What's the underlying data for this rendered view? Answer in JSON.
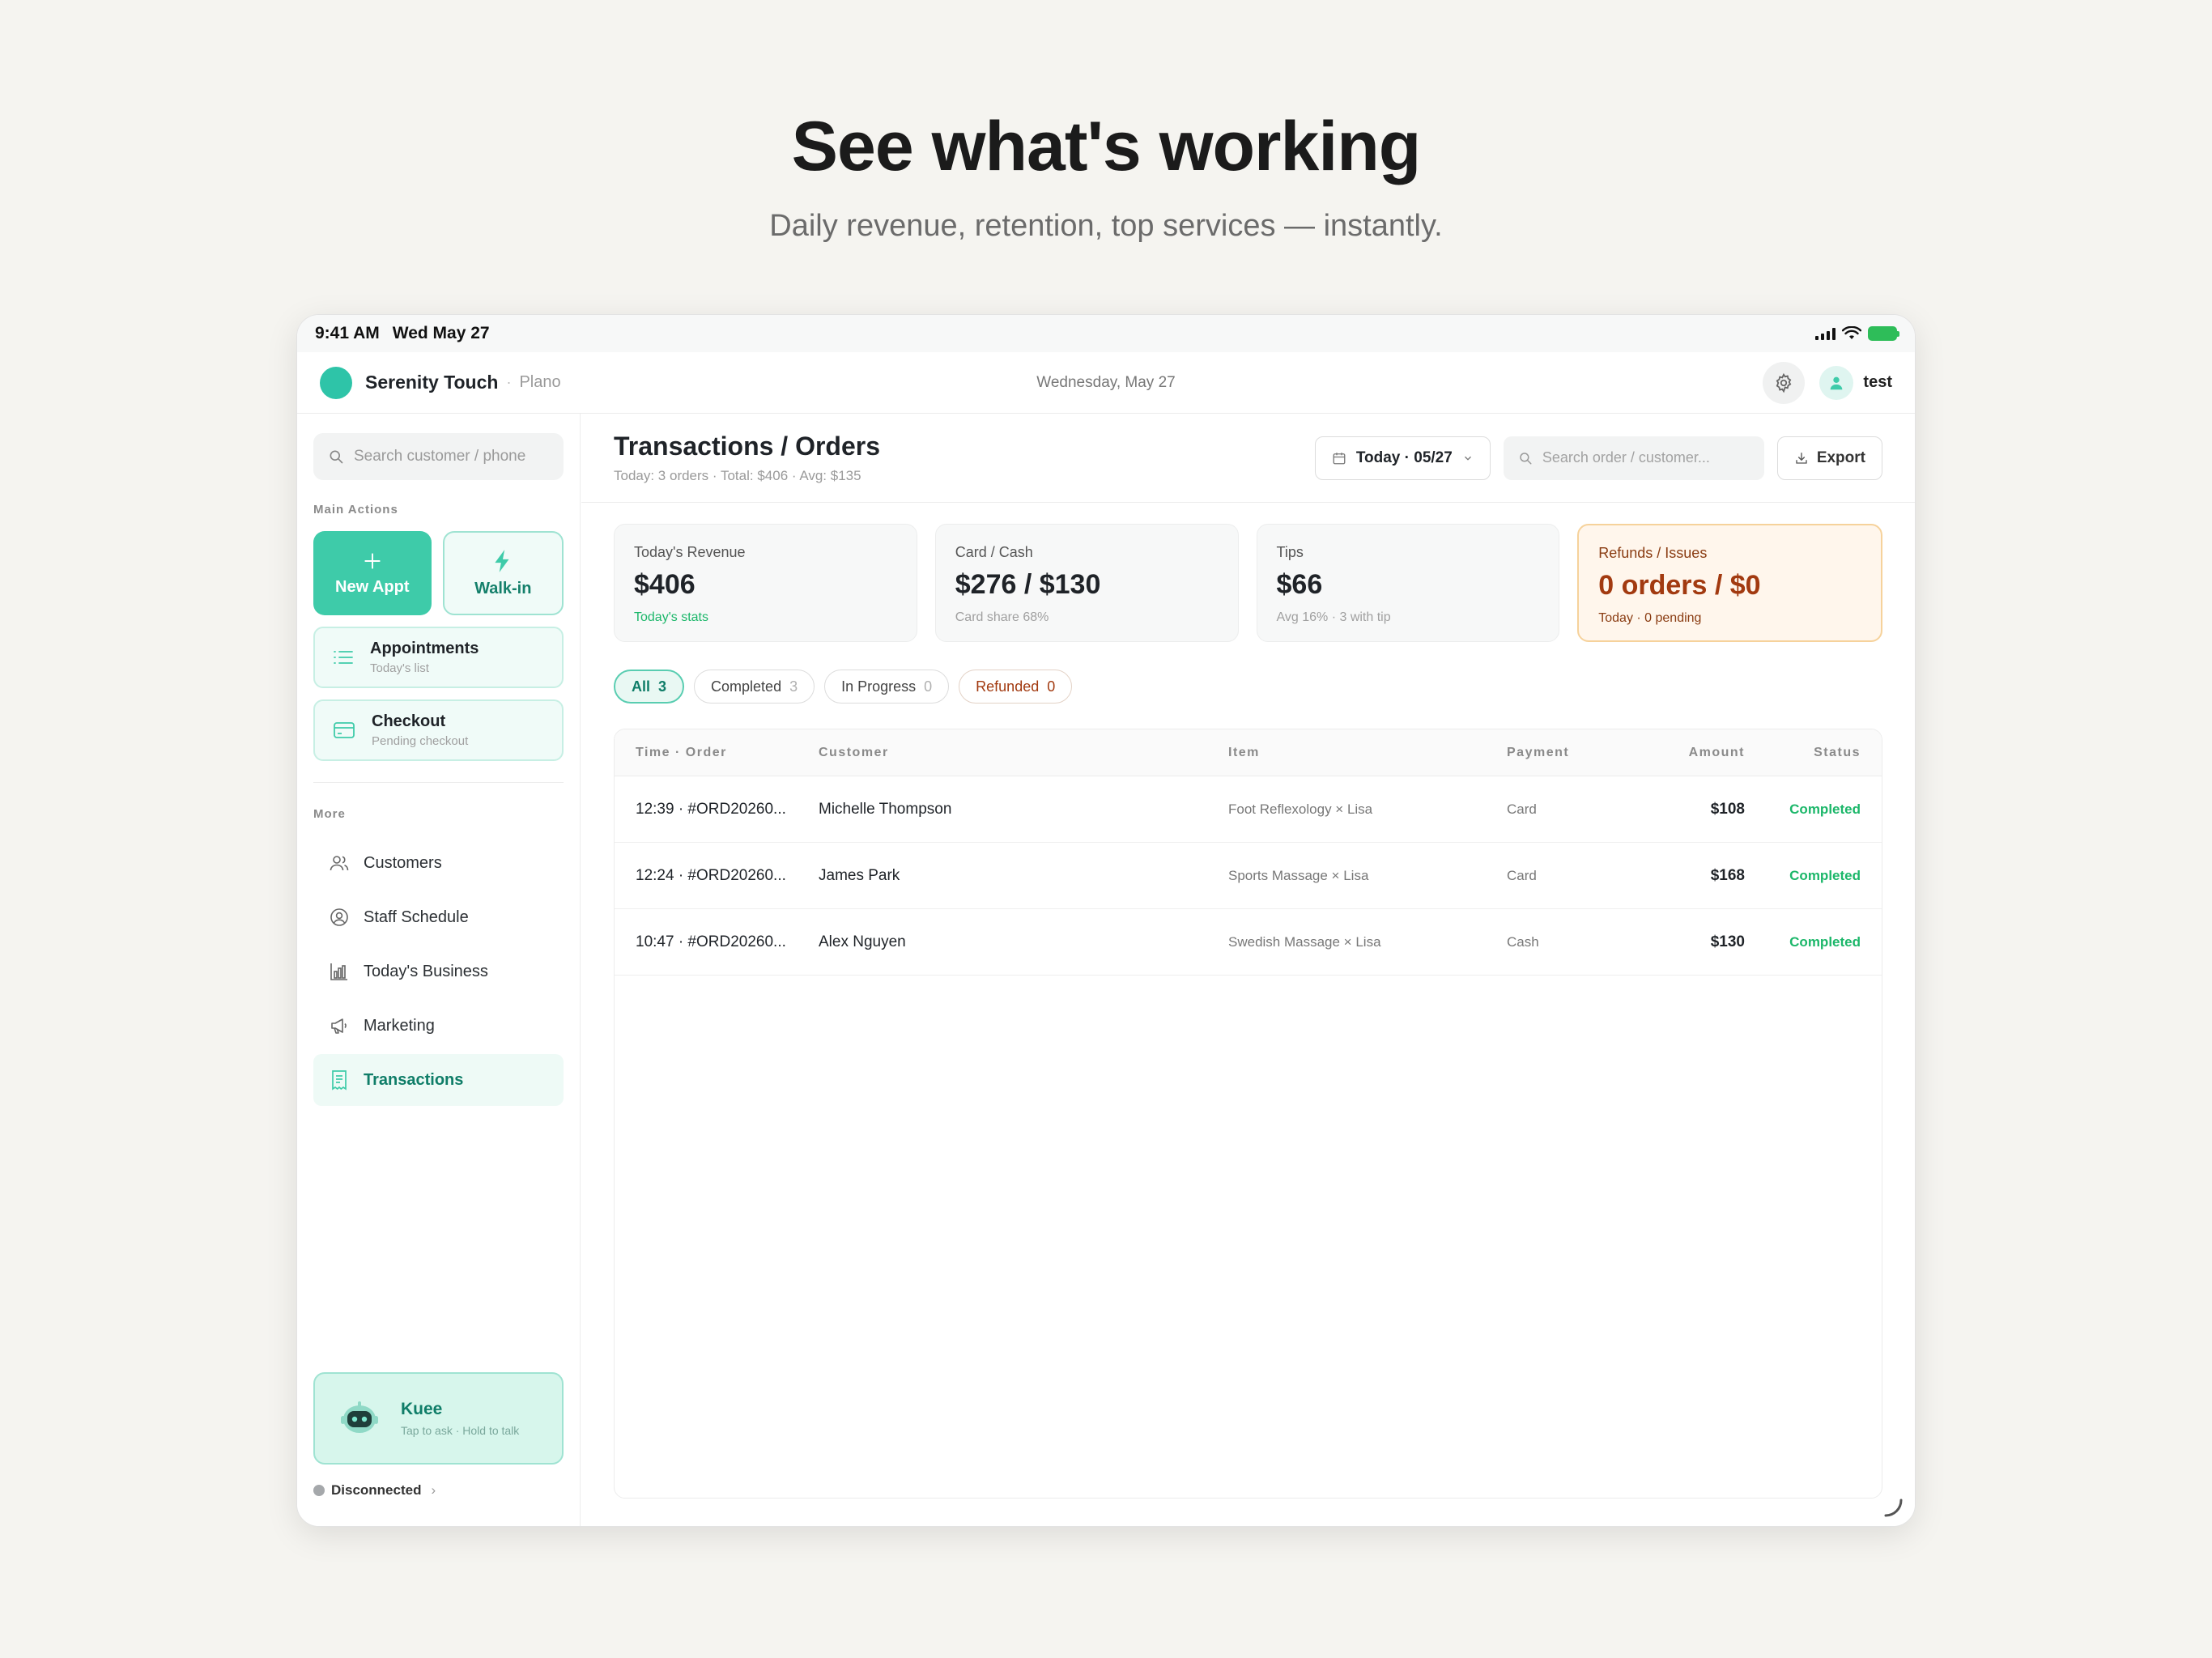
{
  "hero": {
    "title": "See what's working",
    "subtitle": "Daily revenue, retention, top services — instantly."
  },
  "statusbar": {
    "time": "9:41 AM",
    "date": "Wed May 27"
  },
  "header": {
    "brand": "Serenity Touch",
    "separator": "·",
    "location": "Plano",
    "date": "Wednesday, May 27",
    "user": "test"
  },
  "sidebar": {
    "search_placeholder": "Search customer / phone",
    "main_actions_label": "Main Actions",
    "new_appt": "New Appt",
    "walk_in": "Walk-in",
    "appointments": {
      "title": "Appointments",
      "subtitle": "Today's list"
    },
    "checkout": {
      "title": "Checkout",
      "subtitle": "Pending checkout"
    },
    "more_label": "More",
    "more_items": [
      {
        "label": "Customers",
        "icon": "users-icon"
      },
      {
        "label": "Staff Schedule",
        "icon": "user-circle-icon"
      },
      {
        "label": "Today's Business",
        "icon": "bar-chart-icon"
      },
      {
        "label": "Marketing",
        "icon": "megaphone-icon"
      },
      {
        "label": "Transactions",
        "icon": "receipt-icon",
        "active": true
      }
    ],
    "assistant": {
      "name": "Kuee",
      "hint": "Tap to ask · Hold to talk"
    },
    "connection": {
      "status": "Disconnected",
      "chevron": "›"
    }
  },
  "main": {
    "title": "Transactions / Orders",
    "subtitle": "Today: 3 orders · Total: $406 · Avg: $135",
    "date_filter": "Today · 05/27",
    "search_placeholder": "Search order / customer...",
    "export": "Export"
  },
  "stats": [
    {
      "label": "Today's Revenue",
      "value": "$406",
      "note": "Today's stats"
    },
    {
      "label": "Card / Cash",
      "value": "$276 / $130",
      "note": "Card share 68%"
    },
    {
      "label": "Tips",
      "value": "$66",
      "note": "Avg 16% · 3 with tip"
    },
    {
      "label": "Refunds / Issues",
      "value": "0 orders / $0",
      "note": "Today · 0 pending"
    }
  ],
  "filters": [
    {
      "label": "All",
      "count": "3"
    },
    {
      "label": "Completed",
      "count": "3"
    },
    {
      "label": "In Progress",
      "count": "0"
    },
    {
      "label": "Refunded",
      "count": "0"
    }
  ],
  "table": {
    "columns": [
      "Time · Order",
      "Customer",
      "Item",
      "Payment",
      "Amount",
      "Status"
    ],
    "rows": [
      {
        "time_order": "12:39 · #ORD20260...",
        "customer": "Michelle Thompson",
        "item": "Foot Reflexology × Lisa",
        "payment": "Card",
        "amount": "$108",
        "status": "Completed"
      },
      {
        "time_order": "12:24 · #ORD20260...",
        "customer": "James Park",
        "item": "Sports Massage × Lisa",
        "payment": "Card",
        "amount": "$168",
        "status": "Completed"
      },
      {
        "time_order": "10:47 · #ORD20260...",
        "customer": "Alex Nguyen",
        "item": "Swedish Massage × Lisa",
        "payment": "Cash",
        "amount": "$130",
        "status": "Completed"
      }
    ]
  },
  "colors": {
    "accent": "#3ecba9",
    "accent_dark": "#0f7d68",
    "success": "#1cb76a",
    "warning_text": "#a23a10",
    "warning_bg": "#fff6ec"
  }
}
